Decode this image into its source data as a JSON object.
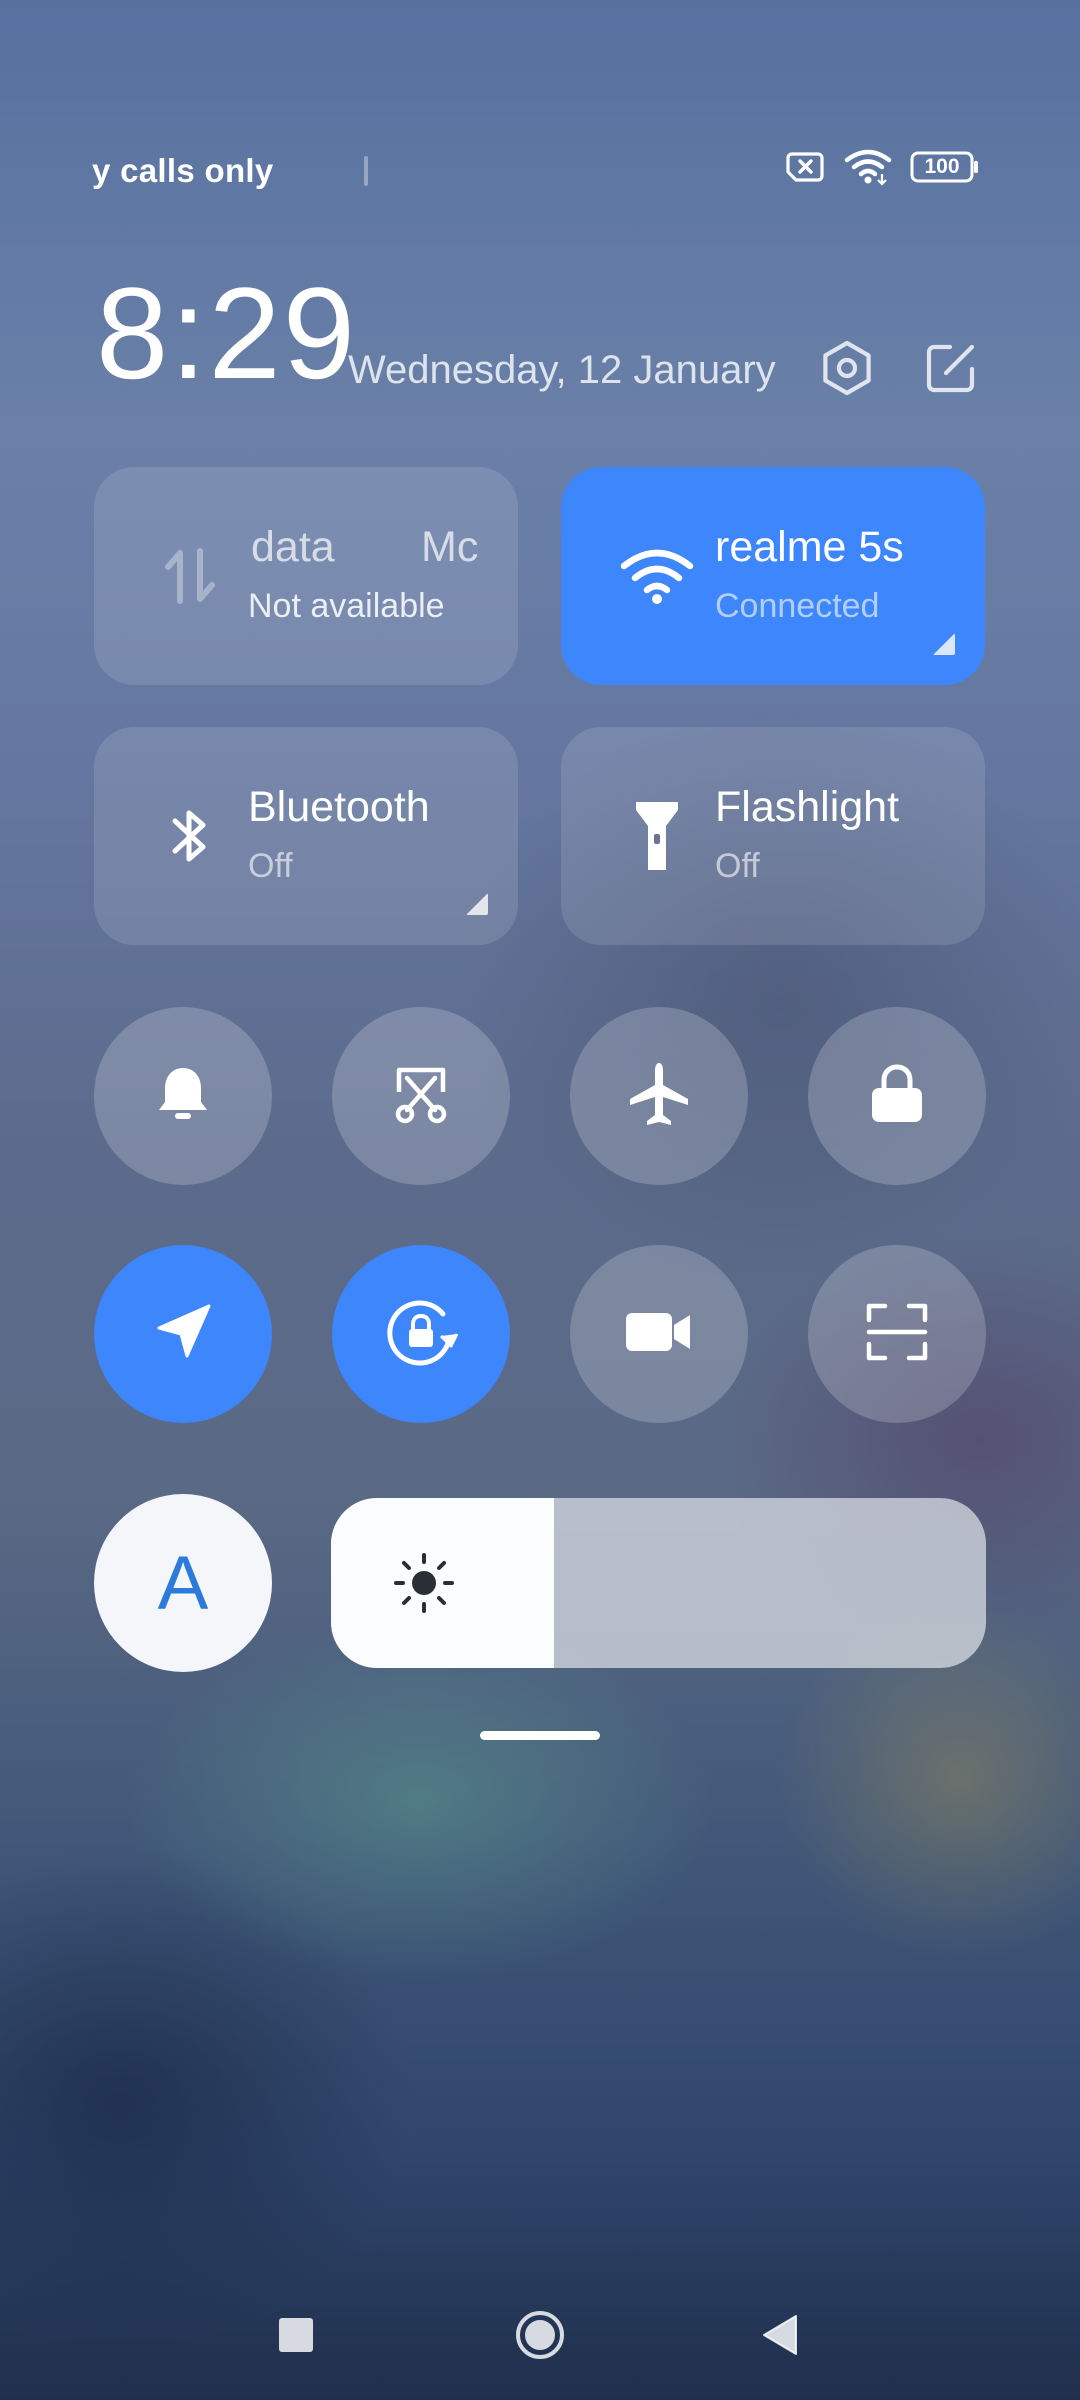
{
  "status_bar": {
    "carrier": "y calls only",
    "battery": "100",
    "icons": [
      "no-sim-icon",
      "wifi-icon",
      "battery-icon"
    ]
  },
  "header": {
    "time": "8:29",
    "date": "Wednesday, 12 January",
    "settings_icon": "settings-icon",
    "edit_icon": "edit-icon"
  },
  "tiles": {
    "mobile_data": {
      "title_left": "data",
      "title_right": "Mc",
      "status": "Not available",
      "icon": "mobile-data-icon"
    },
    "wifi": {
      "title": "realme 5s",
      "status": "Connected",
      "icon": "wifi-icon",
      "active": true
    },
    "bluetooth": {
      "title": "Bluetooth",
      "status": "Off",
      "icon": "bluetooth-icon"
    },
    "flashlight": {
      "title": "Flashlight",
      "status": "Off",
      "icon": "flashlight-icon"
    }
  },
  "toggles": [
    {
      "name": "mute",
      "icon": "bell-icon",
      "active": false
    },
    {
      "name": "screenshot",
      "icon": "scissors-icon",
      "active": false
    },
    {
      "name": "airplane-mode",
      "icon": "airplane-icon",
      "active": false
    },
    {
      "name": "lock-screen",
      "icon": "lock-icon",
      "active": false
    },
    {
      "name": "location",
      "icon": "location-arrow-icon",
      "active": true
    },
    {
      "name": "rotation-lock",
      "icon": "rotation-lock-icon",
      "active": true
    },
    {
      "name": "screen-recorder",
      "icon": "video-camera-icon",
      "active": false
    },
    {
      "name": "scanner",
      "icon": "scan-icon",
      "active": false
    }
  ],
  "auto_brightness": {
    "label": "A",
    "icon": "auto-brightness-icon"
  },
  "brightness": {
    "level": 0.34,
    "icon": "sun-icon"
  },
  "nav": {
    "icons": [
      "recents-icon",
      "home-icon",
      "back-icon"
    ]
  },
  "colors": {
    "accent": "#3d86fb",
    "auto_letter": "#2c7ad9"
  }
}
